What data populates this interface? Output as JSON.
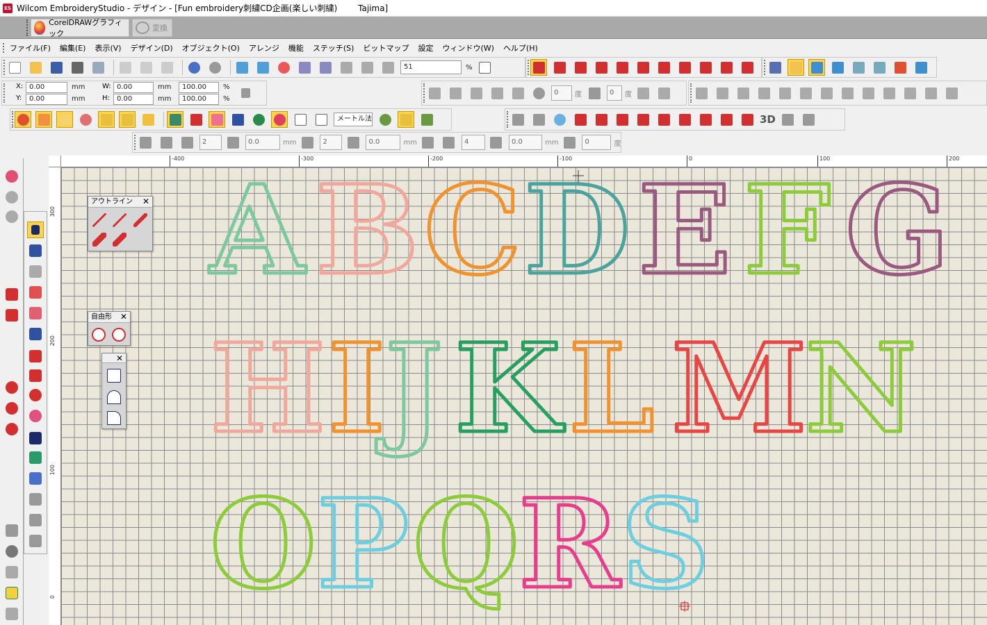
{
  "window": {
    "app_title": "Wilcom EmbroideryStudio - デザイン - [Fun embroidery刺繍CD企画(楽しい刺繍)",
    "machine": "Tajima]",
    "app_icon": "ES"
  },
  "top_band": {
    "coreldraw_label": "CorelDRAWグラフィック",
    "convert_label": "変換"
  },
  "menu": [
    "ファイル(F)",
    "編集(E)",
    "表示(V)",
    "デザイン(D)",
    "オブジェクト(O)",
    "アレンジ",
    "機能",
    "ステッチ(S)",
    "ビットマップ",
    "設定",
    "ウィンドウ(W)",
    "ヘルプ(H)"
  ],
  "standard_toolbar": {
    "zoom_value": "51",
    "zoom_unit": "%"
  },
  "properties": {
    "x_label": "X:",
    "x_value": "0.00",
    "y_label": "Y:",
    "y_value": "0.00",
    "w_label": "W:",
    "w_value": "0.00",
    "h_label": "H:",
    "h_value": "0.00",
    "unit": "mm",
    "w_percent": "100.00",
    "h_percent": "100.00",
    "percent_sign": "%",
    "rotate_value": "0",
    "skew_value": "0",
    "degree_unit": "度"
  },
  "stitch_toolbar": {
    "unit_select": "メートル法",
    "threed_label": "3D"
  },
  "spacing_toolbar": {
    "count1": "2",
    "value1": "0.0",
    "unit1": "mm",
    "count2": "2",
    "value2": "0.0",
    "unit2": "mm",
    "count3": "4",
    "value3": "0.0",
    "unit3": "mm",
    "angle": "0",
    "angle_unit": "度"
  },
  "rulers": {
    "h_ticks": [
      "-400",
      "-300",
      "-200",
      "-100",
      "0",
      "100",
      "200"
    ],
    "v_ticks": [
      "300",
      "200",
      "100",
      "0"
    ]
  },
  "panels": {
    "outline_title": "アウトライン",
    "free_title": "自由形"
  },
  "design": {
    "letters": [
      {
        "ch": "A",
        "color": "#7ec8a0"
      },
      {
        "ch": "B",
        "color": "#f0a89c"
      },
      {
        "ch": "C",
        "color": "#f0922e"
      },
      {
        "ch": "D",
        "color": "#4aa39c"
      },
      {
        "ch": "E",
        "color": "#9a5a80"
      },
      {
        "ch": "F",
        "color": "#8ccc3a"
      },
      {
        "ch": "G",
        "color": "#9a5a80"
      },
      {
        "ch": "H",
        "color": "#f0a89c"
      },
      {
        "ch": "I",
        "color": "#f0922e"
      },
      {
        "ch": "J",
        "color": "#7ec8a0"
      },
      {
        "ch": "K",
        "color": "#25a060"
      },
      {
        "ch": "L",
        "color": "#f0922e"
      },
      {
        "ch": "M",
        "color": "#e84545"
      },
      {
        "ch": "N",
        "color": "#8ccc3a"
      },
      {
        "ch": "O",
        "color": "#8ccc3a"
      },
      {
        "ch": "P",
        "color": "#6ccfe0"
      },
      {
        "ch": "Q",
        "color": "#8ccc3a"
      },
      {
        "ch": "R",
        "color": "#e83c8c"
      },
      {
        "ch": "S",
        "color": "#6ccfe0"
      }
    ]
  }
}
